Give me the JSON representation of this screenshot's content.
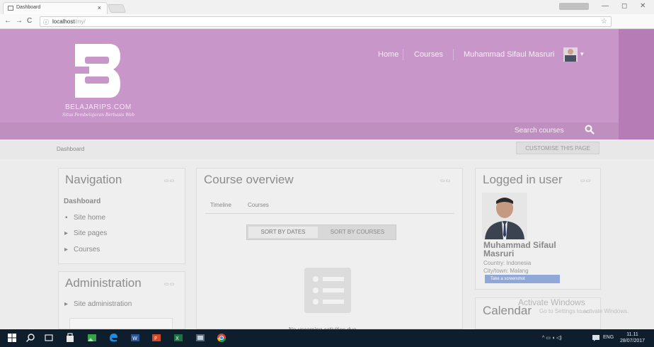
{
  "browser": {
    "tab_title": "Dashboard",
    "tab_close": "×",
    "user_chip": "",
    "url_host": "localhost",
    "url_path": "/my/",
    "nav": {
      "back": "←",
      "forward": "→",
      "reload": "C",
      "info": "ⓘ"
    },
    "window_controls": {
      "minimize": "—",
      "restore": "◻",
      "close": "✕"
    },
    "star": "☆",
    "menu": "⋮",
    "extension": "◆"
  },
  "site": {
    "logo_text": "BELAJARIPS.COM",
    "logo_subtitle": "Situs Pembelajaran Berbasis Web",
    "nav": [
      "Home",
      "Courses",
      "Muhammad Sifaul Masruri"
    ],
    "caret": "▾",
    "search_label": "Search courses",
    "breadcrumb": "Dashboard",
    "customise_button": "CUSTOMISE THIS PAGE"
  },
  "navigation_block": {
    "title": "Navigation",
    "controls": "▭▭",
    "dashboard": "Dashboard",
    "items": [
      {
        "bullet": "▪",
        "label": "Site home"
      },
      {
        "bullet": "▸",
        "label": "Site pages"
      },
      {
        "bullet": "▸",
        "label": "Courses"
      }
    ]
  },
  "admin_block": {
    "title": "Administration",
    "controls": "▭▭",
    "items": [
      {
        "bullet": "▸",
        "label": "Site administration"
      }
    ]
  },
  "course_overview": {
    "title": "Course overview",
    "controls": "▭▭",
    "tabs": [
      "Timeline",
      "Courses"
    ],
    "sort_dates": "SORT BY DATES",
    "sort_courses": "SORT BY COURSES",
    "empty_text": "No upcoming activities due"
  },
  "logged_in": {
    "title": "Logged in user",
    "controls": "▭▭",
    "name_line1": "Muhammad Sifaul",
    "name_line2": "Masruri",
    "country": "Country: Indonesia",
    "city": "City/town: Malang",
    "screenshot_tip": "Take a screenshot"
  },
  "calendar": {
    "title": "Calendar",
    "controls": "▭▭"
  },
  "activate": {
    "line1": "Activate Windows",
    "line2": "Go to Settings to activate Windows."
  },
  "taskbar": {
    "lang": "ENG",
    "time": "11.11",
    "date": "28/07/2017",
    "tray": "^ ▭ ◖ ◁)"
  },
  "colors": {
    "header": "#c996c9",
    "header_dark": "#b67cb6",
    "taskbar": "#0e1e2c"
  }
}
